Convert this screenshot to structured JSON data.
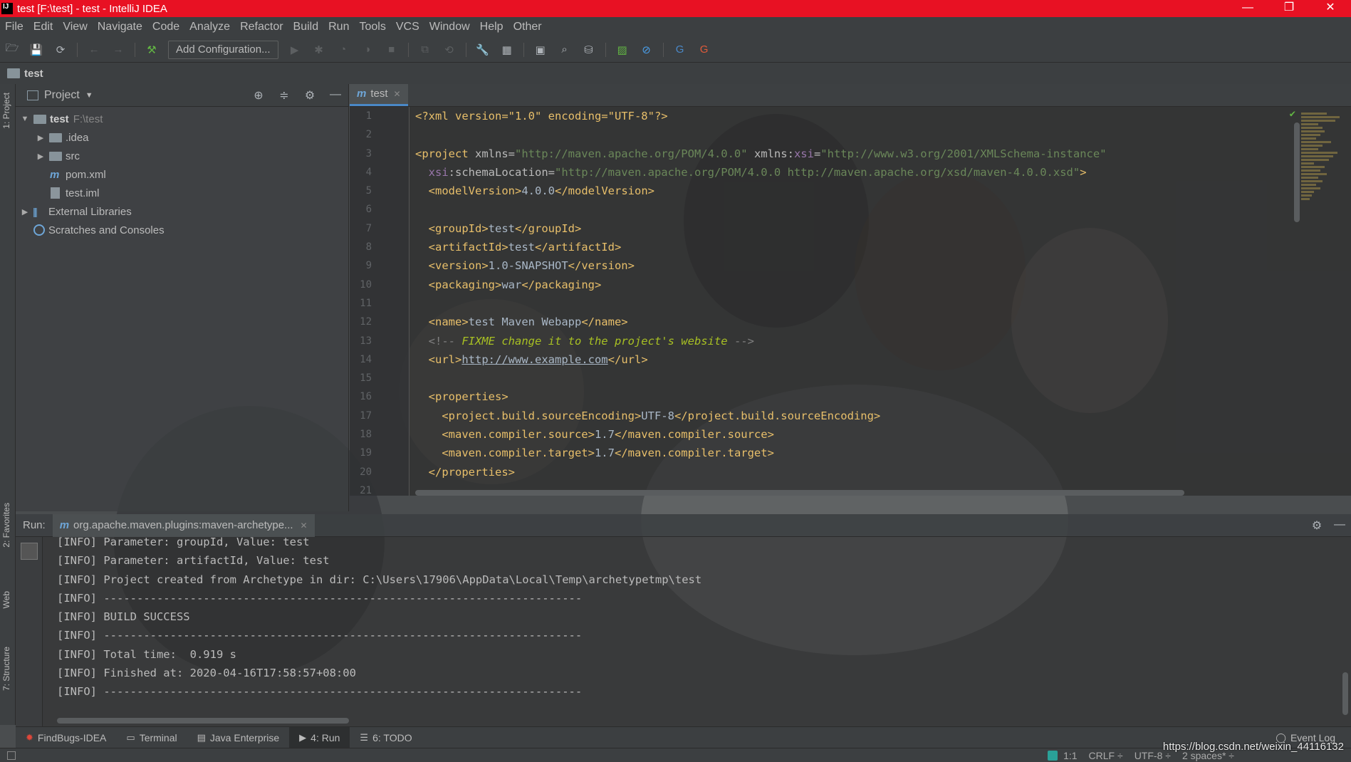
{
  "window": {
    "title": "test [F:\\test] - test - IntelliJ IDEA",
    "controls": [
      "—",
      "❐",
      "✕"
    ]
  },
  "menu": [
    "File",
    "Edit",
    "View",
    "Navigate",
    "Code",
    "Analyze",
    "Refactor",
    "Build",
    "Run",
    "Tools",
    "VCS",
    "Window",
    "Help",
    "Other"
  ],
  "toolbar": {
    "add_configuration": "Add Configuration..."
  },
  "breadcrumb": {
    "project": "test"
  },
  "left_strip": {
    "project_tab": "1: Project",
    "favorites_tab": "2: Favorites",
    "web_tab": "Web",
    "structure_tab": "7: Structure"
  },
  "project_panel": {
    "title": "Project",
    "tree": {
      "root_name": "test",
      "root_path": "F:\\test",
      "idea": ".idea",
      "src": "src",
      "pom": "pom.xml",
      "iml": "test.iml",
      "external": "External Libraries",
      "scratches": "Scratches and Consoles"
    }
  },
  "editor": {
    "tab_label": "test",
    "line_numbers": [
      "1",
      "2",
      "3",
      "4",
      "5",
      "6",
      "7",
      "8",
      "9",
      "10",
      "11",
      "12",
      "13",
      "14",
      "15",
      "16",
      "17",
      "18",
      "19",
      "20",
      "21"
    ],
    "code": {
      "l1_decl": "<?xml version=\"1.0\" encoding=\"UTF-8\"?>",
      "l3_open": "<project",
      "l3_xmlns_attr": " xmlns=",
      "l3_xmlns_val": "\"http://maven.apache.org/POM/4.0.0\"",
      "l3_xsi_attr": " xmlns:",
      "l3_xsi_ns": "xsi",
      "l3_eq": "=",
      "l3_xsi_val": "\"http://www.w3.org/2001/XMLSchema-instance\"",
      "l4_ns": "xsi",
      "l4_attr": ":schemaLocation=",
      "l4_val": "\"http://maven.apache.org/POM/4.0.0 http://maven.apache.org/xsd/maven-4.0.0.xsd\"",
      "l4_close": ">",
      "l5_open": "<modelVersion>",
      "l5_text": "4.0.0",
      "l5_close": "</modelVersion>",
      "l7_open": "<groupId>",
      "l7_text": "test",
      "l7_close": "</groupId>",
      "l8_open": "<artifactId>",
      "l8_text": "test",
      "l8_close": "</artifactId>",
      "l9_open": "<version>",
      "l9_text": "1.0-SNAPSHOT",
      "l9_close": "</version>",
      "l10_open": "<packaging>",
      "l10_text": "war",
      "l10_close": "</packaging>",
      "l12_open": "<name>",
      "l12_text": "test Maven Webapp",
      "l12_close": "</name>",
      "l13_start": "<!-- ",
      "l13_todo": "FIXME change it to the project's website",
      "l13_end": " -->",
      "l14_open": "<url>",
      "l14_text": "http://www.example.com",
      "l14_close": "</url>",
      "l16_open": "<properties>",
      "l17_open": "<project.build.sourceEncoding>",
      "l17_text": "UTF-8",
      "l17_close": "</project.build.sourceEncoding>",
      "l18_open": "<maven.compiler.source>",
      "l18_text": "1.7",
      "l18_close": "</maven.compiler.source>",
      "l19_open": "<maven.compiler.target>",
      "l19_text": "1.7",
      "l19_close": "</maven.compiler.target>",
      "l20_close": "</properties>"
    }
  },
  "run_panel": {
    "label": "Run:",
    "tab_label": "org.apache.maven.plugins:maven-archetype...",
    "console_lines": [
      "[INFO] Parameter: groupId, Value: test",
      "[INFO] Parameter: artifactId, Value: test",
      "[INFO] Project created from Archetype in dir: C:\\Users\\17906\\AppData\\Local\\Temp\\archetypetmp\\test",
      "[INFO] ------------------------------------------------------------------------",
      "[INFO] BUILD SUCCESS",
      "[INFO] ------------------------------------------------------------------------",
      "[INFO] Total time:  0.919 s",
      "[INFO] Finished at: 2020-04-16T17:58:57+08:00",
      "[INFO] ------------------------------------------------------------------------"
    ]
  },
  "bottom_tools": {
    "findbugs": "FindBugs-IDEA",
    "terminal": "Terminal",
    "java_enterprise": "Java Enterprise",
    "run": "4: Run",
    "todo": "6: TODO",
    "event_log": "Event Log"
  },
  "status": {
    "position": "1:1",
    "line_sep": "CRLF ÷",
    "encoding": "UTF-8 ÷",
    "indent": "2 spaces* ÷"
  },
  "watermark": "https://blog.csdn.net/weixin_44116132",
  "colors": {
    "title_bar": "#e81123",
    "chrome": "#3c3f41",
    "editor_bg": "#2b2b2b",
    "xml_tag": "#e8bf6a",
    "xml_value": "#6a8759",
    "namespace": "#9876aa",
    "todo": "#a8c023"
  }
}
